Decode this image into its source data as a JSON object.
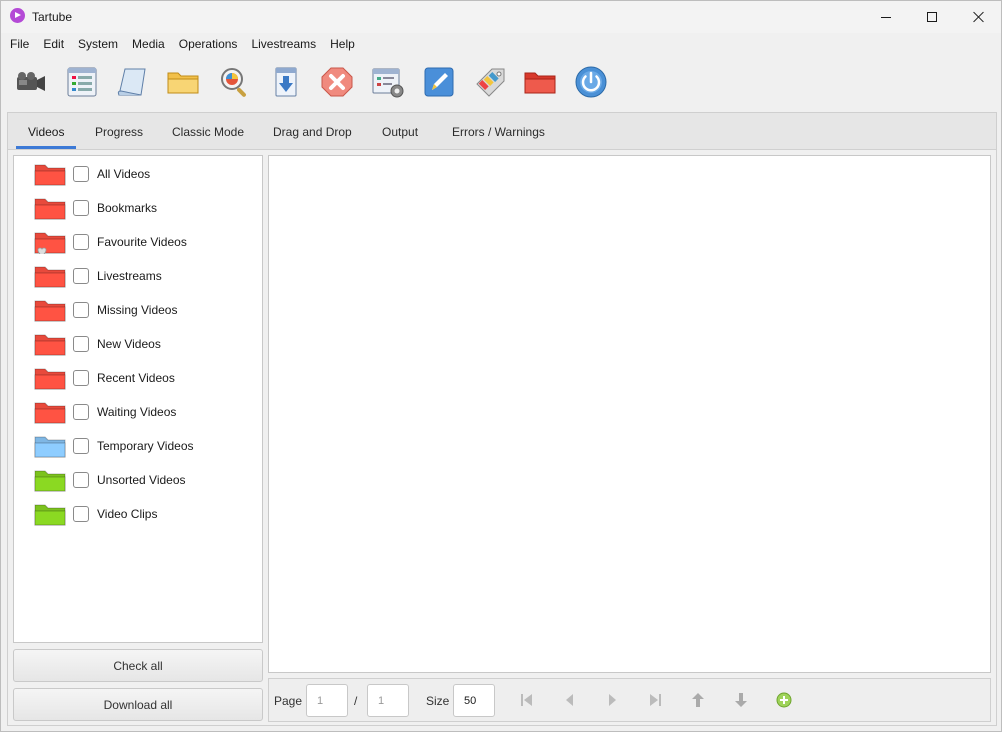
{
  "window": {
    "title": "Tartube"
  },
  "menu": [
    "File",
    "Edit",
    "System",
    "Media",
    "Operations",
    "Livestreams",
    "Help"
  ],
  "toolbar": {
    "buttons": [
      {
        "name": "add-video-icon"
      },
      {
        "name": "add-channel-icon"
      },
      {
        "name": "add-playlist-icon"
      },
      {
        "name": "add-folder-icon"
      },
      {
        "name": "check-all-icon"
      },
      {
        "name": "download-all-icon"
      },
      {
        "name": "stop-icon"
      },
      {
        "name": "preferences-icon"
      },
      {
        "name": "edit-icon"
      },
      {
        "name": "tags-icon"
      },
      {
        "name": "open-folder-icon"
      },
      {
        "name": "quit-icon"
      }
    ]
  },
  "tabs": [
    "Videos",
    "Progress",
    "Classic Mode",
    "Drag and Drop",
    "Output",
    "Errors / Warnings"
  ],
  "folders": [
    {
      "label": "All Videos",
      "color": "#e84a3c"
    },
    {
      "label": "Bookmarks",
      "color": "#e84a3c"
    },
    {
      "label": "Favourite Videos",
      "color": "#e84a3c"
    },
    {
      "label": "Livestreams",
      "color": "#e84a3c"
    },
    {
      "label": "Missing Videos",
      "color": "#e84a3c"
    },
    {
      "label": "New Videos",
      "color": "#e84a3c"
    },
    {
      "label": "Recent Videos",
      "color": "#e84a3c"
    },
    {
      "label": "Waiting Videos",
      "color": "#e84a3c"
    },
    {
      "label": "Temporary Videos",
      "color": "#7fb7e4"
    },
    {
      "label": "Unsorted Videos",
      "color": "#7cc21e"
    },
    {
      "label": "Video Clips",
      "color": "#7cc21e"
    }
  ],
  "buttons": {
    "check_all": "Check all",
    "download_all": "Download all"
  },
  "pager": {
    "page_label": "Page",
    "page_value": "1",
    "separator": "/",
    "page_total": "1",
    "size_label": "Size",
    "size_value": "50"
  }
}
